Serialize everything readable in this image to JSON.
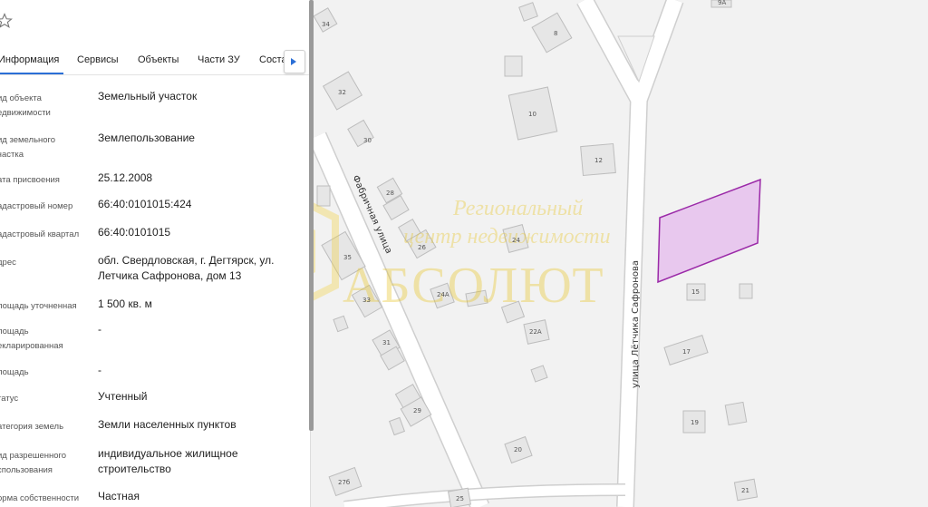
{
  "tabs": [
    {
      "label": "Информация"
    },
    {
      "label": "Сервисы"
    },
    {
      "label": "Объекты"
    },
    {
      "label": "Части ЗУ"
    },
    {
      "label": "Соста"
    }
  ],
  "rows": [
    {
      "label": "ид объекта\nедвижимости",
      "value": "Земельный участок"
    },
    {
      "label": "ид земельного\nчастка",
      "value": "Землепользование"
    },
    {
      "label": "ата присвоения",
      "value": "25.12.2008"
    },
    {
      "label": "адастровый номер",
      "value": "66:40:0101015:424"
    },
    {
      "label": "адастровый квартал",
      "value": "66:40:0101015"
    },
    {
      "label": "дрес",
      "value": "обл. Свердловская, г. Дегтярск, ул.\nЛетчика Сафронова, дом 13"
    },
    {
      "label": "лощадь уточненная",
      "value": "1 500 кв. м"
    },
    {
      "label": "лощадь\nекларированная",
      "value": "-"
    },
    {
      "label": "лощадь",
      "value": "-"
    },
    {
      "label": "татус",
      "value": "Учтенный"
    },
    {
      "label": "атегория земель",
      "value": "Земли населенных пунктов"
    },
    {
      "label": "ид разрешенного\nспользования",
      "value": "индивидуальное жилищное\nстроительство"
    },
    {
      "label": "орма собственности",
      "value": "Частная"
    }
  ],
  "map": {
    "streets": [
      "Фабричная улица",
      "улица Лётчика Сафронова"
    ],
    "house_numbers": [
      "34",
      "8",
      "9А",
      "32",
      "10",
      "30",
      "12",
      "28",
      "26",
      "24",
      "35",
      "24А",
      "33",
      "22А",
      "31",
      "15",
      "17",
      "29",
      "19",
      "20",
      "27б",
      "25",
      "21"
    ],
    "watermark": {
      "line1": "Региональный",
      "line2": "центр недвижимости",
      "brand": "АБСОЛЮТ"
    },
    "parcel_color": "#e8c8ee",
    "parcel_border": "#9b2aa8"
  },
  "colors": {
    "accent": "#2b6fd6",
    "road": "#ffffff",
    "road_edge": "#cfcfcf",
    "building": "#e6e6e6"
  }
}
